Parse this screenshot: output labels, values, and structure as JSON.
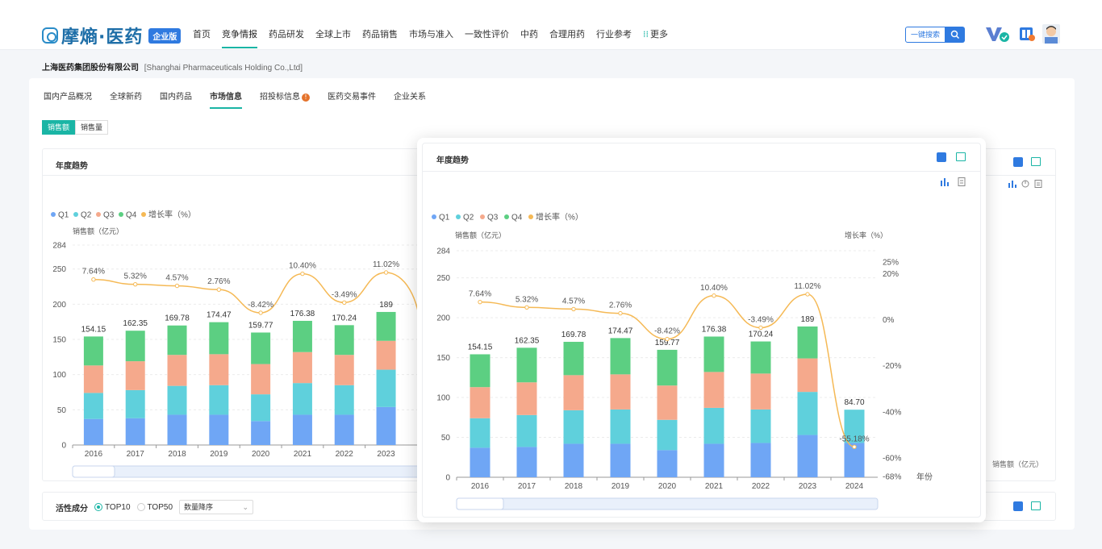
{
  "brand": {
    "name": "摩熵·医药",
    "badge": "企业版"
  },
  "nav": [
    "首页",
    "竞争情报",
    "药品研发",
    "全球上市",
    "药品销售",
    "市场与准入",
    "一致性评价",
    "中药",
    "合理用药",
    "行业参考"
  ],
  "nav_active": 1,
  "nav_more": "更多",
  "search": {
    "label": "一键搜索"
  },
  "company": {
    "name": "上海医药集团股份有限公司",
    "name_en": "[Shanghai Pharmaceuticals Holding Co.,Ltd]"
  },
  "subtabs": [
    "国内产品概况",
    "全球新药",
    "国内药品",
    "市场信息",
    "招投标信息",
    "医药交易事件",
    "企业关系"
  ],
  "subtab_active": 3,
  "subtab_warn": "!",
  "toggle": {
    "sales_amount": "销售额",
    "sales_volume": "销售量"
  },
  "card": {
    "title": "年度趋势"
  },
  "popup": {
    "title": "年度趋势"
  },
  "bottom_card": {
    "label": "活性成分",
    "top10": "TOP10",
    "top50": "TOP50",
    "sort": "数量降序"
  },
  "right_card": {
    "axis_label": "销售额（亿元）"
  },
  "colors": {
    "q1": "#6fa6f5",
    "q2": "#5fd0dc",
    "q3": "#f5a98c",
    "q4": "#5ccf82",
    "growth": "#f5b955",
    "accent": "#1ab5a5"
  },
  "chart_data": [
    {
      "type": "bar",
      "title": "年度趋势",
      "ylabel": "销售额（亿元）",
      "ylim": [
        0,
        284
      ],
      "yticks": [
        0,
        50,
        100,
        150,
        200,
        250,
        284
      ],
      "categories": [
        "2016",
        "2017",
        "2018",
        "2019",
        "2020",
        "2021",
        "2022",
        "2023"
      ],
      "series": [
        {
          "name": "Q1",
          "values": [
            37,
            38,
            43,
            43,
            34,
            43,
            43,
            54
          ]
        },
        {
          "name": "Q2",
          "values": [
            37,
            40,
            41,
            42,
            38,
            45,
            42,
            53
          ]
        },
        {
          "name": "Q3",
          "values": [
            39,
            41,
            44,
            44,
            43,
            44,
            43,
            41
          ]
        },
        {
          "name": "Q4",
          "values": [
            41.15,
            43.35,
            41.78,
            45.47,
            44.77,
            44.38,
            42.24,
            41
          ]
        }
      ],
      "totals": [
        "154.15",
        "162.35",
        "169.78",
        "174.47",
        "159.77",
        "176.38",
        "170.24",
        "189"
      ],
      "growth_name": "增长率（%）",
      "growth": [
        7.64,
        5.32,
        4.57,
        2.76,
        -8.42,
        10.4,
        -3.49,
        11.02
      ],
      "growth_labels": [
        "7.64%",
        "5.32%",
        "4.57%",
        "2.76%",
        "-8.42%",
        "10.40%",
        "-3.49%",
        "11.02%"
      ],
      "partial_label": "-5"
    },
    {
      "type": "bar",
      "title": "年度趋势",
      "ylabel": "销售额（亿元）",
      "y2label": "增长率（%）",
      "xlabel": "年份",
      "ylim": [
        0,
        284
      ],
      "yticks": [
        0,
        50,
        100,
        150,
        200,
        250,
        284
      ],
      "y2lim": [
        -68,
        25
      ],
      "y2ticks": [
        "25%",
        "20%",
        "0%",
        "-20%",
        "-40%",
        "-60%",
        "-68%"
      ],
      "categories": [
        "2016",
        "2017",
        "2018",
        "2019",
        "2020",
        "2021",
        "2022",
        "2023",
        "2024"
      ],
      "series": [
        {
          "name": "Q1",
          "values": [
            37,
            38,
            42,
            42,
            34,
            42,
            43,
            53,
            43
          ]
        },
        {
          "name": "Q2",
          "values": [
            37,
            40,
            42,
            43,
            38,
            45,
            42,
            54,
            41.7
          ]
        },
        {
          "name": "Q3",
          "values": [
            39,
            41,
            44,
            44,
            43,
            45,
            45,
            42,
            0
          ]
        },
        {
          "name": "Q4",
          "values": [
            41.15,
            43.35,
            41.78,
            45.47,
            44.77,
            44.38,
            40.24,
            40,
            0
          ]
        }
      ],
      "totals": [
        "154.15",
        "162.35",
        "169.78",
        "174.47",
        "159.77",
        "176.38",
        "170.24",
        "189",
        "84.70"
      ],
      "growth_name": "增长率（%）",
      "growth": [
        7.64,
        5.32,
        4.57,
        2.76,
        -8.42,
        10.4,
        -3.49,
        11.02,
        -55.18
      ],
      "growth_labels": [
        "7.64%",
        "5.32%",
        "4.57%",
        "2.76%",
        "-8.42%",
        "10.40%",
        "-3.49%",
        "11.02%",
        "-55.18%"
      ]
    }
  ]
}
